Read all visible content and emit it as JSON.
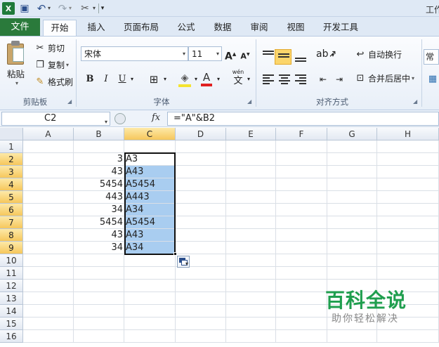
{
  "window": {
    "title": "工作"
  },
  "ribbon_tabs": {
    "file": "文件",
    "tabs": [
      "开始",
      "插入",
      "页面布局",
      "公式",
      "数据",
      "审阅",
      "视图",
      "开发工具"
    ],
    "active": "开始"
  },
  "clipboard": {
    "paste": "粘贴",
    "cut": "剪切",
    "copy": "复制",
    "format_painter": "格式刷",
    "label": "剪贴板"
  },
  "font": {
    "name": "宋体",
    "size": "11",
    "grow": "A",
    "shrink": "A",
    "bold": "B",
    "italic": "I",
    "underline": "U",
    "font_color_glyph": "A",
    "phonetic_glyph": "wén",
    "phonetic_char": "文",
    "label": "字体"
  },
  "alignment": {
    "wrap_text": "自动换行",
    "merge_center": "合并后居中",
    "label": "对齐方式"
  },
  "number": {
    "format_cut": "常规"
  },
  "formula_bar": {
    "name_box": "C2",
    "fx": "fx",
    "formula": "=\"A\"&B2"
  },
  "sheet": {
    "columns": [
      "A",
      "B",
      "C",
      "D",
      "E",
      "F",
      "G",
      "H"
    ],
    "selected_column": "C",
    "rows": [
      "1",
      "2",
      "3",
      "4",
      "5",
      "6",
      "7",
      "8",
      "9",
      "10",
      "11",
      "12",
      "13",
      "14",
      "15",
      "16"
    ],
    "selected_rows": [
      "2",
      "3",
      "4",
      "5",
      "6",
      "7",
      "8",
      "9"
    ],
    "column_B": [
      "",
      "3",
      "43",
      "5454",
      "443",
      "34",
      "5454",
      "43",
      "34"
    ],
    "column_C": [
      "",
      "A3",
      "A43",
      "A5454",
      "A443",
      "A34",
      "A5454",
      "A43",
      "A34"
    ],
    "active_cell": "C2",
    "selection_color": "#a9cdf0"
  },
  "watermark": {
    "title": "百科全说",
    "subtitle": "助你轻松解决"
  }
}
